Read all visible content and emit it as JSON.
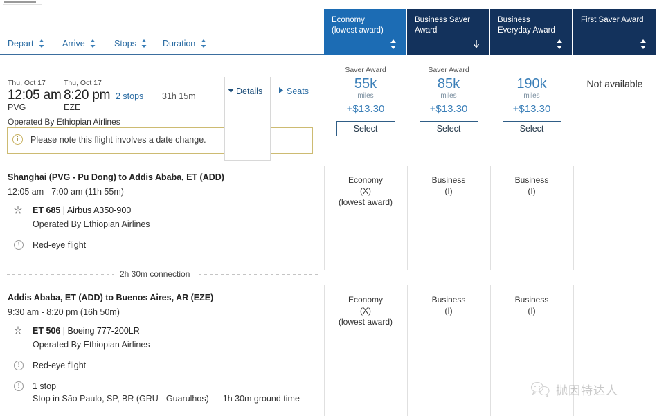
{
  "sort_bar": {
    "items": [
      {
        "label": "Depart",
        "icon": "sort-updown-icon"
      },
      {
        "label": "Arrive",
        "icon": "sort-updown-icon"
      },
      {
        "label": "Stops",
        "icon": "sort-updown-icon"
      },
      {
        "label": "Duration",
        "icon": "sort-updown-icon"
      }
    ]
  },
  "fare_tabs": [
    {
      "label": "Economy\n(lowest award)",
      "active": true,
      "sort_icon": "sort-updown-icon"
    },
    {
      "label": "Business Saver\nAward",
      "active": false,
      "sort_icon": "sort-down-icon"
    },
    {
      "label": "Business\nEveryday Award",
      "active": false,
      "sort_icon": "sort-updown-icon"
    },
    {
      "label": "First Saver Award",
      "active": false,
      "sort_icon": "sort-updown-icon"
    }
  ],
  "summary": {
    "depart_date": "Thu, Oct 17",
    "depart_time": "12:05 am",
    "depart_code": "PVG",
    "arrive_date": "Thu, Oct 17",
    "arrive_time": "8:20 pm",
    "arrive_code": "EZE",
    "stops": "2 stops",
    "duration": "31h 15m",
    "operated_by": "Operated By Ethiopian Airlines",
    "details_label": "Details",
    "seats_label": "Seats",
    "notice": "Please note this flight involves a date change.",
    "notice_icon": "info-icon"
  },
  "price_columns": [
    {
      "saver": "Saver Award",
      "miles": "55k",
      "unit": "miles",
      "tax": "+$13.30",
      "select": "Select",
      "unavailable": ""
    },
    {
      "saver": "Saver Award",
      "miles": "85k",
      "unit": "miles",
      "tax": "+$13.30",
      "select": "Select",
      "unavailable": ""
    },
    {
      "saver": "",
      "miles": "190k",
      "unit": "miles",
      "tax": "+$13.30",
      "select": "Select",
      "unavailable": ""
    },
    {
      "saver": "",
      "miles": "",
      "unit": "",
      "tax": "",
      "select": "",
      "unavailable": "Not available"
    }
  ],
  "segments": [
    {
      "title": "Shanghai (PVG - Pu Dong) to Addis Ababa, ET (ADD)",
      "times": "12:05 am - 7:00 am (11h 55m)",
      "flight_number": "ET 685",
      "separator": "|",
      "aircraft": "Airbus A350-900",
      "operated_by": "Operated By Ethiopian Airlines",
      "alliance_icon": "star-alliance-icon",
      "notes": [
        {
          "icon": "alert-icon",
          "label": "Red-eye flight",
          "sub": "",
          "ground": ""
        }
      ],
      "cabins": [
        {
          "name": "Economy",
          "code": "(X)",
          "extra": "(lowest award)"
        },
        {
          "name": "Business",
          "code": "(I)",
          "extra": ""
        },
        {
          "name": "Business",
          "code": "(I)",
          "extra": ""
        }
      ]
    },
    {
      "title": "Addis Ababa, ET (ADD) to Buenos Aires, AR (EZE)",
      "times": "9:30 am - 8:20 pm (16h 50m)",
      "flight_number": "ET 506",
      "separator": "|",
      "aircraft": "Boeing 777-200LR",
      "operated_by": "Operated By Ethiopian Airlines",
      "alliance_icon": "star-alliance-icon",
      "notes": [
        {
          "icon": "alert-icon",
          "label": "Red-eye flight",
          "sub": "",
          "ground": ""
        },
        {
          "icon": "alert-icon",
          "label": "1 stop",
          "sub": "Stop in São Paulo, SP, BR (GRU - Guarulhos)",
          "ground": "1h 30m ground time"
        }
      ],
      "cabins": [
        {
          "name": "Economy",
          "code": "(X)",
          "extra": "(lowest award)"
        },
        {
          "name": "Business",
          "code": "(I)",
          "extra": ""
        },
        {
          "name": "Business",
          "code": "(I)",
          "extra": ""
        }
      ]
    }
  ],
  "connection": {
    "label": "2h 30m connection"
  },
  "watermark": {
    "text": "抛因特达人",
    "icon": "wechat-icon"
  },
  "colors": {
    "tab_active": "#1c6cb4",
    "tab_inactive": "#13325c",
    "link": "#2b6ca3",
    "miles": "#3b7fb8",
    "notice_border": "#cdbb72"
  }
}
